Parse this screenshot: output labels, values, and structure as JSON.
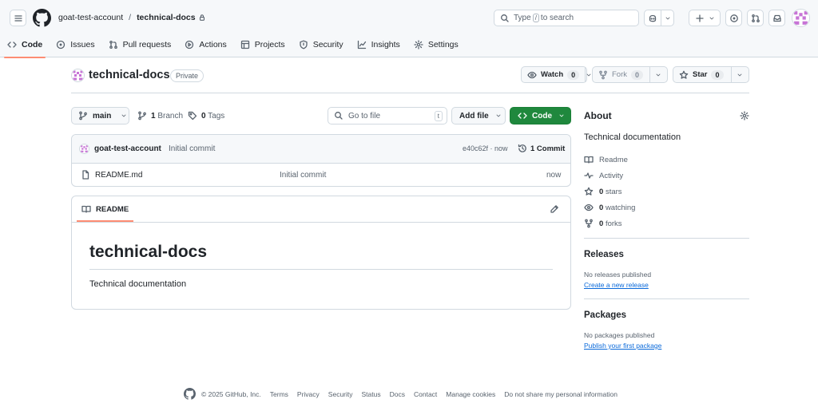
{
  "header": {
    "owner": "goat-test-account",
    "separator": "/",
    "repo": "technical-docs",
    "search_prefix": "Type",
    "search_key": "/",
    "search_suffix": "to search"
  },
  "tabs": [
    {
      "label": "Code",
      "icon": "code-icon"
    },
    {
      "label": "Issues",
      "icon": "issue-icon"
    },
    {
      "label": "Pull requests",
      "icon": "pull-request-icon"
    },
    {
      "label": "Actions",
      "icon": "play-icon"
    },
    {
      "label": "Projects",
      "icon": "table-icon"
    },
    {
      "label": "Security",
      "icon": "shield-icon"
    },
    {
      "label": "Insights",
      "icon": "graph-icon"
    },
    {
      "label": "Settings",
      "icon": "gear-icon"
    }
  ],
  "repo": {
    "name": "technical-docs",
    "visibility": "Private",
    "watch_label": "Watch",
    "watch_count": "0",
    "fork_label": "Fork",
    "fork_count": "0",
    "star_label": "Star",
    "star_count": "0"
  },
  "toolbar": {
    "branch": "main",
    "branch_count": "1",
    "branch_label": "Branch",
    "tag_count": "0",
    "tag_label": "Tags",
    "goto_placeholder": "Go to file",
    "goto_key": "t",
    "add_file_label": "Add file",
    "code_label": "Code"
  },
  "commit": {
    "author": "goat-test-account",
    "message": "Initial commit",
    "sha": "e40c62f",
    "time": "now",
    "count_label": "1 Commit"
  },
  "files": [
    {
      "name": "README.md",
      "commit": "Initial commit",
      "time": "now"
    }
  ],
  "readme": {
    "tab_label": "README",
    "heading": "technical-docs",
    "body": "Technical documentation"
  },
  "about": {
    "title": "About",
    "description": "Technical documentation",
    "links": [
      {
        "icon": "book-icon",
        "count": "",
        "label": "Readme"
      },
      {
        "icon": "pulse-icon",
        "count": "",
        "label": "Activity"
      },
      {
        "icon": "star-icon",
        "count": "0",
        "label": "stars"
      },
      {
        "icon": "eye-icon",
        "count": "0",
        "label": "watching"
      },
      {
        "icon": "fork-icon",
        "count": "0",
        "label": "forks"
      }
    ]
  },
  "releases": {
    "title": "Releases",
    "text": "No releases published",
    "link": "Create a new release"
  },
  "packages": {
    "title": "Packages",
    "text": "No packages published",
    "link": "Publish your first package"
  },
  "footer": {
    "copyright": "© 2025 GitHub, Inc.",
    "links": [
      "Terms",
      "Privacy",
      "Security",
      "Status",
      "Docs",
      "Contact",
      "Manage cookies",
      "Do not share my personal information"
    ]
  },
  "colors": {
    "accent_underline": "#fd8c73",
    "code_button": "#1f883d",
    "link": "#0969da",
    "border": "#d1d9e0"
  }
}
